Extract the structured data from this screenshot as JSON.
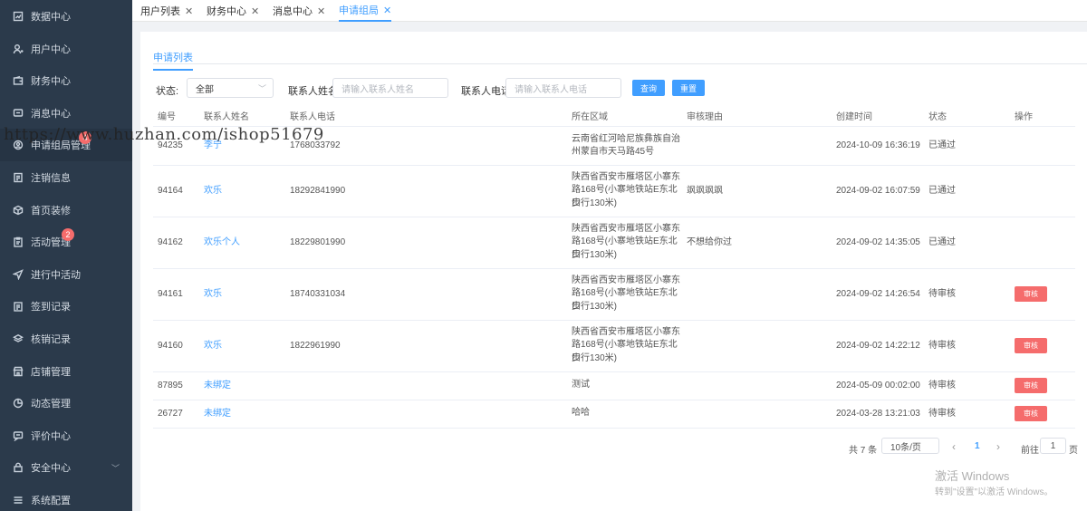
{
  "sidebar": {
    "items": [
      {
        "label": "数据中心",
        "icon": "chart-icon"
      },
      {
        "label": "用户中心",
        "icon": "user-icon"
      },
      {
        "label": "财务中心",
        "icon": "wallet-icon"
      },
      {
        "label": "消息中心",
        "icon": "message-icon"
      },
      {
        "label": "申请组局管理",
        "icon": "profile-icon",
        "badge": "4"
      },
      {
        "label": "注销信息",
        "icon": "document-icon"
      },
      {
        "label": "首页装修",
        "icon": "cube-icon"
      },
      {
        "label": "活动管理",
        "icon": "clipboard-icon",
        "badge": "2"
      },
      {
        "label": "进行中活动",
        "icon": "send-icon"
      },
      {
        "label": "签到记录",
        "icon": "checklist-icon"
      },
      {
        "label": "核销记录",
        "icon": "layers-icon"
      },
      {
        "label": "店铺管理",
        "icon": "shop-icon"
      },
      {
        "label": "动态管理",
        "icon": "pie-icon"
      },
      {
        "label": "评价中心",
        "icon": "comment-icon"
      },
      {
        "label": "安全中心",
        "icon": "lock-icon"
      },
      {
        "label": "系统配置",
        "icon": "menu-icon"
      }
    ]
  },
  "tabs": [
    {
      "label": "用户列表"
    },
    {
      "label": "财务中心"
    },
    {
      "label": "消息中心"
    },
    {
      "label": "申请组局"
    }
  ],
  "subtab": "申请列表",
  "filters": {
    "status_label": "状态:",
    "status_value": "全部",
    "name_label": "联系人姓名:",
    "name_placeholder": "请输入联系人姓名",
    "phone_label": "联系人电话:",
    "phone_placeholder": "请输入联系人电话",
    "query_button": "查询",
    "reset_button": "重置"
  },
  "table": {
    "columns": [
      "编号",
      "联系人姓名",
      "联系人电话",
      "所在区域",
      "审核理由",
      "创建时间",
      "状态",
      "操作"
    ],
    "rows": [
      {
        "id": "94235",
        "name": "李宁",
        "phone": "17680337​92",
        "region": [
          "云南省红河哈尼族彝族自治",
          "州蒙自市天马路45号"
        ],
        "reason": "",
        "created": "2024-10-09 16:36:19",
        "status": "已通过",
        "action": ""
      },
      {
        "id": "94164",
        "name": "欢乐",
        "phone": "18292841990",
        "region": [
          "陕西省西安市雁塔区小寨东",
          "路168号(小寨地铁站E东北口",
          "步行130米)"
        ],
        "reason": "飒飒飒飒",
        "created": "2024-09-02 16:07:59",
        "status": "已通过",
        "action": ""
      },
      {
        "id": "94162",
        "name": "欢乐个人",
        "phone": "18229801990",
        "region": [
          "陕西省西安市雁塔区小寨东",
          "路168号(小寨地铁站E东北口",
          "步行130米)"
        ],
        "reason": "不想给你过",
        "created": "2024-09-02 14:35:05",
        "status": "已通过",
        "action": ""
      },
      {
        "id": "94161",
        "name": "欢乐",
        "phone": "18740331034",
        "region": [
          "陕西省西安市雁塔区小寨东",
          "路168号(小寨地铁站E东北口",
          "步行130米)"
        ],
        "reason": "",
        "created": "2024-09-02 14:26:54",
        "status": "待审核",
        "action": "审核"
      },
      {
        "id": "94160",
        "name": "欢乐",
        "phone": "1822961990",
        "region": [
          "陕西省西安市雁塔区小寨东",
          "路168号(小寨地铁站E东北口",
          "步行130米)"
        ],
        "reason": "",
        "created": "2024-09-02 14:22:12",
        "status": "待审核",
        "action": "审核"
      },
      {
        "id": "87895",
        "name": "未绑定",
        "phone": "",
        "region": [
          "测试"
        ],
        "reason": "",
        "created": "2024-05-09 00:02:00",
        "status": "待审核",
        "action": "审核"
      },
      {
        "id": "26727",
        "name": "未绑定",
        "phone": "",
        "region": [
          "哈哈"
        ],
        "reason": "",
        "created": "2024-03-28 13:21:03",
        "status": "待审核",
        "action": "审核"
      }
    ]
  },
  "pagination": {
    "total": "共 7 条",
    "page_size": "10条/页",
    "prev": "‹",
    "current": "1",
    "next": "›",
    "goto_label": "前往",
    "goto_value": "1",
    "page_unit": "页"
  },
  "overlay": {
    "watermark": "https://www.huzhan.com/ishop51679",
    "activate_title": "激活 Windows",
    "activate_sub": "转到\"设置\"以激活 Windows。"
  },
  "colors": {
    "primary": "#409eff",
    "danger": "#f56c6c",
    "sidebar": "#2b3a4b"
  }
}
